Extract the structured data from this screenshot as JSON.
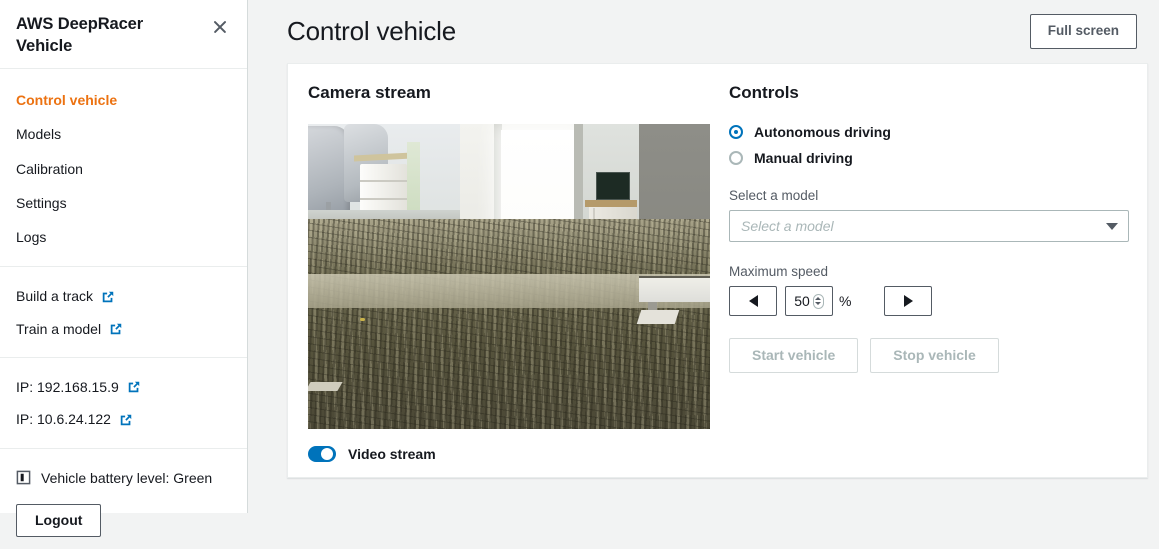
{
  "sidebar": {
    "title": "AWS DeepRacer Vehicle",
    "close_icon": "close-icon",
    "nav": [
      {
        "label": "Control vehicle",
        "active": true
      },
      {
        "label": "Models",
        "active": false
      },
      {
        "label": "Calibration",
        "active": false
      },
      {
        "label": "Settings",
        "active": false
      },
      {
        "label": "Logs",
        "active": false
      }
    ],
    "links": [
      {
        "label": "Build a track",
        "icon": "external-link-icon"
      },
      {
        "label": "Train a model",
        "icon": "external-link-icon"
      }
    ],
    "ips": [
      {
        "label": "IP: 192.168.15.9",
        "icon": "external-link-icon"
      },
      {
        "label": "IP: 10.6.24.122",
        "icon": "external-link-icon"
      }
    ],
    "battery": {
      "label": "Vehicle battery level: Green",
      "icon": "battery-icon"
    },
    "logout_label": "Logout"
  },
  "header": {
    "title": "Control vehicle",
    "fullscreen_label": "Full screen"
  },
  "camera": {
    "section_title": "Camera stream",
    "video_stream_label": "Video stream",
    "video_stream_on": true
  },
  "controls": {
    "section_title": "Controls",
    "driving_modes": [
      {
        "label": "Autonomous driving",
        "selected": true
      },
      {
        "label": "Manual driving",
        "selected": false
      }
    ],
    "model": {
      "field_label": "Select a model",
      "placeholder": "Select a model",
      "value": "",
      "caret_icon": "chevron-down-icon"
    },
    "speed": {
      "field_label": "Maximum speed",
      "decrement_icon": "triangle-left-icon",
      "increment_icon": "triangle-right-icon",
      "value": "50",
      "unit": "%"
    },
    "start_label": "Start vehicle",
    "stop_label": "Stop vehicle"
  },
  "colors": {
    "accent_orange": "#ec7211",
    "link_blue": "#0073bb",
    "page_bg": "#f2f3f3",
    "text": "#16191f",
    "muted": "#545b64",
    "disabled": "#aab7b8"
  }
}
